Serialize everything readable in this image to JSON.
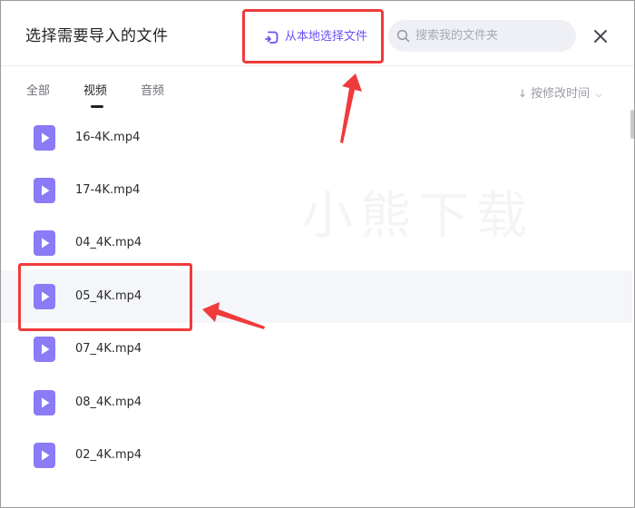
{
  "dialog": {
    "title": "选择需要导入的文件",
    "close_icon": "close-icon"
  },
  "header": {
    "local_button_label": "从本地选择文件",
    "local_button_icon": "folder-import-icon",
    "search_placeholder": "搜索我的文件夹",
    "search_icon": "search-icon"
  },
  "tabs": [
    {
      "label": "全部",
      "active": false
    },
    {
      "label": "视频",
      "active": true
    },
    {
      "label": "音频",
      "active": false
    }
  ],
  "sort": {
    "label": "按修改时间",
    "icon": "sort-down-arrow-icon"
  },
  "files": [
    {
      "name": "16-4K.mp4"
    },
    {
      "name": "17-4K.mp4"
    },
    {
      "name": "04_4K.mp4"
    },
    {
      "name": "05_4K.mp4"
    },
    {
      "name": "07_4K.mp4"
    },
    {
      "name": "08_4K.mp4"
    },
    {
      "name": "02_4K.mp4"
    }
  ],
  "watermark": "小熊下载",
  "colors": {
    "accent": "#6b4ff5",
    "file_icon": "#8b7bf7",
    "annotation_red": "#ef3b3b"
  }
}
